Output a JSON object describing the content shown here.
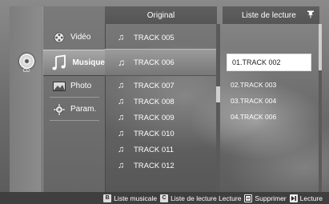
{
  "device": {
    "label": "CD",
    "icon": "cd-disc-icon"
  },
  "menu": {
    "items": [
      {
        "label": "Vidéo",
        "icon": "film-reel-icon",
        "active": false
      },
      {
        "label": "Musique",
        "icon": "music-note-icon",
        "active": true
      },
      {
        "label": "Photo",
        "icon": "photo-icon",
        "active": false
      },
      {
        "label": "Param.",
        "icon": "gear-icon",
        "active": false
      }
    ]
  },
  "original": {
    "header": "Original",
    "tracks": [
      "TRACK 005",
      "TRACK 006",
      "TRACK 007",
      "TRACK 008",
      "TRACK 009",
      "TRACK 010",
      "TRACK 011",
      "TRACK 012"
    ],
    "focused_index": 1
  },
  "playlist": {
    "header": "Liste de lecture",
    "pin_icon": "pin-icon",
    "items": [
      "01.TRACK 002",
      "02.TRACK 003",
      "03.TRACK 004",
      "04.TRACK 006"
    ],
    "selected_index": 0
  },
  "bottom_bar": {
    "b_key": "B",
    "b_label": "Liste musicale",
    "c_key": "C",
    "c_label": "Liste de lecture Lecture",
    "delete_label": "Supprimer",
    "play_label": "Lecture"
  }
}
